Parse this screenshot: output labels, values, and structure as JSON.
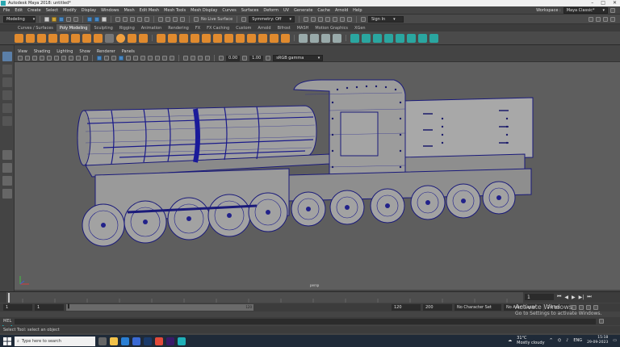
{
  "window": {
    "title": "Autodesk Maya 2018: untitled*"
  },
  "menus": [
    "File",
    "Edit",
    "Create",
    "Select",
    "Modify",
    "Display",
    "Windows",
    "Mesh",
    "Edit Mesh",
    "Mesh Tools",
    "Mesh Display",
    "Curves",
    "Surfaces",
    "Deform",
    "UV",
    "Generate",
    "Cache",
    "Arnold",
    "Help"
  ],
  "workspace": {
    "label": "Workspace :",
    "value": "Maya Classic*"
  },
  "status": {
    "menuset": "Modeling",
    "live_surface": "No Live Surface",
    "symmetry": "Symmetry: Off",
    "sign_in": "Sign In"
  },
  "shelf_tabs": [
    "Curves / Surfaces",
    "Poly Modeling",
    "Sculpting",
    "Rigging",
    "Animation",
    "Rendering",
    "FX",
    "FX Caching",
    "Custom",
    "Arnold",
    "Bifrost",
    "MASH",
    "Motion Graphics",
    "XGen"
  ],
  "shelf_active": "Poly Modeling",
  "panel_menus": [
    "View",
    "Shading",
    "Lighting",
    "Show",
    "Renderer",
    "Panels"
  ],
  "panel_toolbar": {
    "value_a": "0.00",
    "value_b": "1.00",
    "colorspace": "sRGB gamma"
  },
  "viewport": {
    "camera": "persp"
  },
  "timeline": {
    "current_frame": "1"
  },
  "range": {
    "start": "1",
    "inner_start": "1",
    "slider_end": "120",
    "inner_end": "120",
    "end": "200",
    "character_set": "No Character Set",
    "anim_layer": "No Anim Layer",
    "fps": "24 fps"
  },
  "cmdline": {
    "label": "MEL"
  },
  "helpline": {
    "text": "Select Tool: select an object"
  },
  "watermark": {
    "line1": "Activate Windows",
    "line2": "Go to Settings to activate Windows."
  },
  "taskbar": {
    "search_placeholder": "Type here to search",
    "weather_temp": "31°C",
    "weather_desc": "Mostly cloudy",
    "lang": "ENG",
    "time": "15:18",
    "date": "29-09-2023"
  }
}
